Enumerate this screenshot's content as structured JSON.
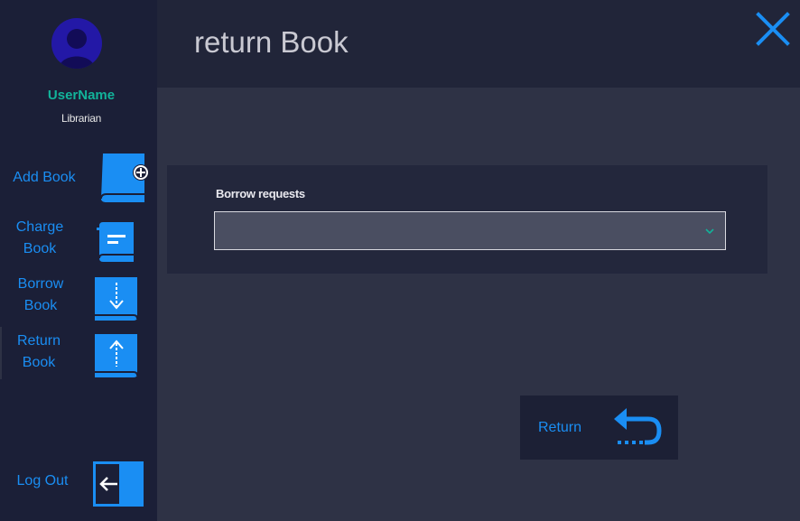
{
  "header": {
    "title": "return Book"
  },
  "user": {
    "name": "UserName",
    "role": "Librarian"
  },
  "sidebar": {
    "items": [
      {
        "label": "Add Book",
        "icon": "add-book-icon"
      },
      {
        "label": "Charge Book",
        "icon": "charge-book-icon"
      },
      {
        "label": "Borrow Book",
        "icon": "borrow-book-icon"
      },
      {
        "label": "Return Book",
        "icon": "return-book-icon",
        "active": true
      }
    ],
    "logout_label": "Log Out"
  },
  "form": {
    "borrow_requests_label": "Borrow requests",
    "borrow_requests_value": ""
  },
  "actions": {
    "return_label": "Return"
  },
  "colors": {
    "accent": "#1a8ef3",
    "username": "#12b39a",
    "sidebar_bg": "#1b1f37",
    "content_bg": "#2e3245",
    "header_bg": "#212539"
  }
}
